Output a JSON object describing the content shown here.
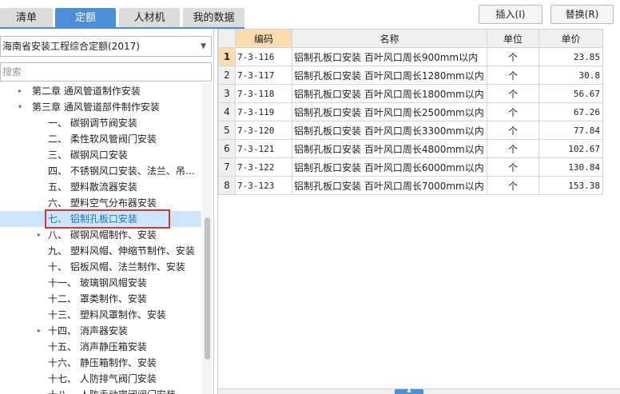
{
  "tabs": [
    {
      "label": "清单"
    },
    {
      "label": "定额"
    },
    {
      "label": "人材机"
    },
    {
      "label": "我的数据"
    }
  ],
  "toolbar": {
    "insert_label": "插入(I)",
    "replace_label": "替换(R)"
  },
  "left": {
    "quota_select": "海南省安装工程综合定额(2017)",
    "search_placeholder": "搜索"
  },
  "tree": [
    {
      "label": "第二章  通风管道制作安装",
      "toggle": "▸",
      "level": 1
    },
    {
      "label": "第三章  通风管道部件制作安装",
      "toggle": "▾",
      "level": 1
    },
    {
      "label": "一、  碳钢调节阀安装",
      "toggle": "",
      "level": 2
    },
    {
      "label": "二、  柔性软风管阀门安装",
      "toggle": "",
      "level": 2
    },
    {
      "label": "三、  碳钢风口安装",
      "toggle": "",
      "level": 2
    },
    {
      "label": "四、  不锈钢风口安装、法兰、吊…",
      "toggle": "",
      "level": 2
    },
    {
      "label": "五、  塑料散流器安装",
      "toggle": "",
      "level": 2
    },
    {
      "label": "六、  塑料空气分布器安装",
      "toggle": "",
      "level": 2
    },
    {
      "label": "七、  铝制孔板口安装",
      "toggle": "",
      "level": 2,
      "selected": true
    },
    {
      "label": "八、  碳钢风帽制作、安装",
      "toggle": "▸",
      "level": 2
    },
    {
      "label": "九、  塑料风帽、伸缩节制作、安装",
      "toggle": "",
      "level": 2
    },
    {
      "label": "十、  铝板风帽、法兰制作、安装",
      "toggle": "",
      "level": 2
    },
    {
      "label": "十一、  玻璃钢风帽安装",
      "toggle": "",
      "level": 2
    },
    {
      "label": "十二、  罩类制作、安装",
      "toggle": "",
      "level": 2
    },
    {
      "label": "十三、  塑料风罩制作、安装",
      "toggle": "",
      "level": 2
    },
    {
      "label": "十四、  消声器安装",
      "toggle": "▸",
      "level": 2
    },
    {
      "label": "十五、  消声静压箱安装",
      "toggle": "",
      "level": 2
    },
    {
      "label": "十六、  静压箱制作、安装",
      "toggle": "",
      "level": 2
    },
    {
      "label": "十七、  人防排气阀门安装",
      "toggle": "",
      "level": 2
    },
    {
      "label": "十八、  人防手动密闭阀门安装",
      "toggle": "",
      "level": 2
    }
  ],
  "grid": {
    "headers": {
      "code": "编码",
      "name": "名称",
      "unit": "单位",
      "price": "单价"
    },
    "rows": [
      {
        "n": "1",
        "code": "7-3-116",
        "name": "铝制孔板口安装 百叶风口周长900mm以内",
        "unit": "个",
        "price": "23.85"
      },
      {
        "n": "2",
        "code": "7-3-117",
        "name": "铝制孔板口安装 百叶风口周长1280mm以内",
        "unit": "个",
        "price": "30.8"
      },
      {
        "n": "3",
        "code": "7-3-118",
        "name": "铝制孔板口安装 百叶风口周长1800mm以内",
        "unit": "个",
        "price": "56.67"
      },
      {
        "n": "4",
        "code": "7-3-119",
        "name": "铝制孔板口安装 百叶风口周长2500mm以内",
        "unit": "个",
        "price": "67.26"
      },
      {
        "n": "5",
        "code": "7-3-120",
        "name": "铝制孔板口安装 百叶风口周长3300mm以内",
        "unit": "个",
        "price": "77.84"
      },
      {
        "n": "6",
        "code": "7-3-121",
        "name": "铝制孔板口安装 百叶风口周长4800mm以内",
        "unit": "个",
        "price": "102.67"
      },
      {
        "n": "7",
        "code": "7-3-122",
        "name": "铝制孔板口安装 百叶风口周长6000mm以内",
        "unit": "个",
        "price": "130.84"
      },
      {
        "n": "8",
        "code": "7-3-123",
        "name": "铝制孔板口安装 百叶风口周长7000mm以内",
        "unit": "个",
        "price": "153.38"
      }
    ]
  },
  "colors": {
    "accent": "#4b8fd9",
    "highlight_border": "#e03030",
    "header_active": "#fbdcae",
    "selection": "#cde6fb"
  }
}
